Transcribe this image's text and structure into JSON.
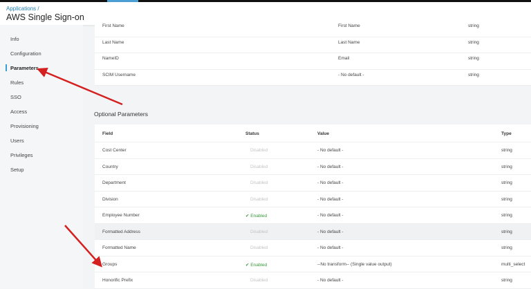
{
  "header": {
    "breadcrumb": "Applications /",
    "title": "AWS Single Sign-on"
  },
  "sidebar": {
    "items": [
      {
        "label": "Info"
      },
      {
        "label": "Configuration"
      },
      {
        "label": "Parameters",
        "active": true
      },
      {
        "label": "Rules"
      },
      {
        "label": "SSO"
      },
      {
        "label": "Access"
      },
      {
        "label": "Provisioning"
      },
      {
        "label": "Users"
      },
      {
        "label": "Privileges"
      },
      {
        "label": "Setup"
      }
    ]
  },
  "required_rows": [
    {
      "field": "First Name",
      "value": "First Name",
      "type": "string"
    },
    {
      "field": "Last Name",
      "value": "Last Name",
      "type": "string"
    },
    {
      "field": "NameID",
      "value": "Email",
      "type": "string"
    },
    {
      "field": "SCIM Username",
      "value": "- No default -",
      "type": "string"
    }
  ],
  "optional": {
    "title": "Optional Parameters",
    "columns": {
      "field": "Field",
      "status": "Status",
      "value": "Value",
      "type": "Type"
    },
    "rows": [
      {
        "field": "Cost Center",
        "status": "Disabled",
        "value": "- No default -",
        "type": "string"
      },
      {
        "field": "Country",
        "status": "Disabled",
        "value": "- No default -",
        "type": "string"
      },
      {
        "field": "Department",
        "status": "Disabled",
        "value": "- No default -",
        "type": "string"
      },
      {
        "field": "Division",
        "status": "Disabled",
        "value": "- No default -",
        "type": "string"
      },
      {
        "field": "Employee Number",
        "status": "✔ Enabled",
        "value": "- No default -",
        "type": "string"
      },
      {
        "field": "Formatted Address",
        "status": "Disabled",
        "value": "- No default -",
        "type": "string"
      },
      {
        "field": "Formatted Name",
        "status": "Disabled",
        "value": "- No default -",
        "type": "string"
      },
      {
        "field": "Groups",
        "status": "✔ Enabled",
        "value": "--No transform-- (Single value output)",
        "type": "multi_select"
      },
      {
        "field": "Honorific Prefix",
        "status": "Disabled",
        "value": "- No default -",
        "type": "string"
      }
    ]
  },
  "colors": {
    "accent": "#1f7fb6",
    "enabled": "#3a9a3a",
    "arrow": "#d42020"
  }
}
